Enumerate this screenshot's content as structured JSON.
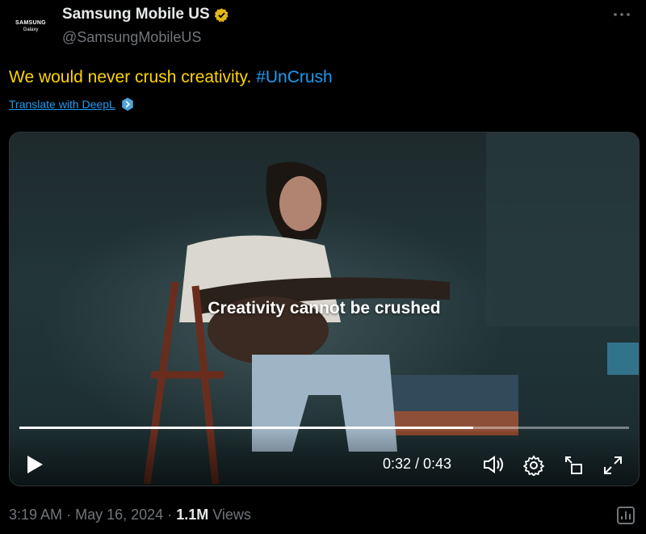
{
  "author": {
    "avatar_line1": "SAMSUNG",
    "avatar_line2": "Galaxy",
    "display_name": "Samsung Mobile US",
    "handle": "@SamsungMobileUS",
    "verified_icon": "gold-verified-badge",
    "more_icon": "more-horizontal-icon"
  },
  "tweet": {
    "text": "We would never crush creativity.",
    "hashtag": "#UnCrush",
    "translate_label": "Translate with DeepL",
    "translate_icon": "deepl-icon"
  },
  "video": {
    "caption": "Creativity cannot be crushed",
    "current_time": "0:32",
    "duration": "0:43",
    "time_display": "0:32 / 0:43",
    "progress_fraction": 0.744,
    "controls": [
      "play-icon",
      "volume-icon",
      "settings-icon",
      "picture-in-picture-icon",
      "fullscreen-icon"
    ]
  },
  "meta": {
    "time": "3:19 AM",
    "separator": "·",
    "date": "May 16, 2024",
    "views_count": "1.1M",
    "views_label": "Views",
    "analytics_icon": "analytics-icon"
  },
  "colors": {
    "background": "#000000",
    "text": "#e7e9ea",
    "muted": "#71767b",
    "link": "#1d9bf0",
    "highlight": "#ffd400",
    "verified": "#e2b719"
  }
}
